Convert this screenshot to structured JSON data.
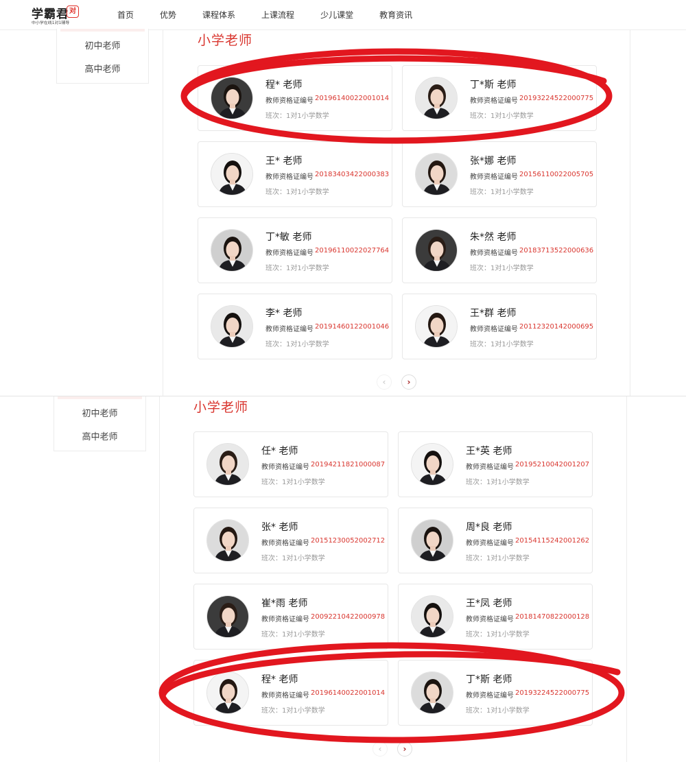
{
  "header": {
    "logo_text": "学霸君",
    "logo_badge": "1对1",
    "logo_slogan": "中小学在线1对1辅导",
    "nav": [
      "首页",
      "优势",
      "课程体系",
      "上课流程",
      "少儿课堂",
      "教育资讯"
    ]
  },
  "sidebar": {
    "items": [
      "初中老师",
      "高中老师"
    ]
  },
  "section_title": "小学老师",
  "cert_label": "教师资格证编号",
  "teacher_suffix": "老师",
  "pager": {
    "prev": "‹",
    "next": "›"
  },
  "panel1": {
    "teachers": [
      {
        "name": "程* 老师",
        "cert": "20196140022001014",
        "class": "班次：1对1小学数学"
      },
      {
        "name": "丁*斯 老师",
        "cert": "20193224522000775",
        "class": "班次：1对1小学数学"
      },
      {
        "name": "王* 老师",
        "cert": "20183403422000383",
        "class": "班次：1对1小学数学"
      },
      {
        "name": "张*娜 老师",
        "cert": "20156110022005705",
        "class": "班次：1对1小学数学"
      },
      {
        "name": "丁*敏 老师",
        "cert": "20196110022027764",
        "class": "班次：1对1小学数学"
      },
      {
        "name": "朱*然 老师",
        "cert": "20183713522000636",
        "class": "班次：1对1小学数学"
      },
      {
        "name": "李* 老师",
        "cert": "20191460122001046",
        "class": "班次：1对1小学数学"
      },
      {
        "name": "王*群 老师",
        "cert": "20112320142000695",
        "class": "班次：1对1小学数学"
      }
    ]
  },
  "panel2": {
    "teachers": [
      {
        "name": "任* 老师",
        "cert": "20194211821000087",
        "class": "班次：1对1小学数学"
      },
      {
        "name": "王*英 老师",
        "cert": "20195210042001207",
        "class": "班次：1对1小学数学"
      },
      {
        "name": "张* 老师",
        "cert": "20151230052002712",
        "class": "班次：1对1小学数学"
      },
      {
        "name": "周*良 老师",
        "cert": "20154115242001262",
        "class": "班次：1对1小学数学"
      },
      {
        "name": "崔*雨 老师",
        "cert": "20092210422000978",
        "class": "班次：1对1小学数学"
      },
      {
        "name": "王*凤 老师",
        "cert": "20181470822000128",
        "class": "班次：1对1小学数学"
      },
      {
        "name": "程* 老师",
        "cert": "20196140022001014",
        "class": "班次：1对1小学数学"
      },
      {
        "name": "丁*斯 老师",
        "cert": "20193224522000775",
        "class": "班次：1对1小学数学"
      }
    ]
  },
  "colors": {
    "accent": "#d9362f",
    "highlight_oval": "#e2171f"
  }
}
